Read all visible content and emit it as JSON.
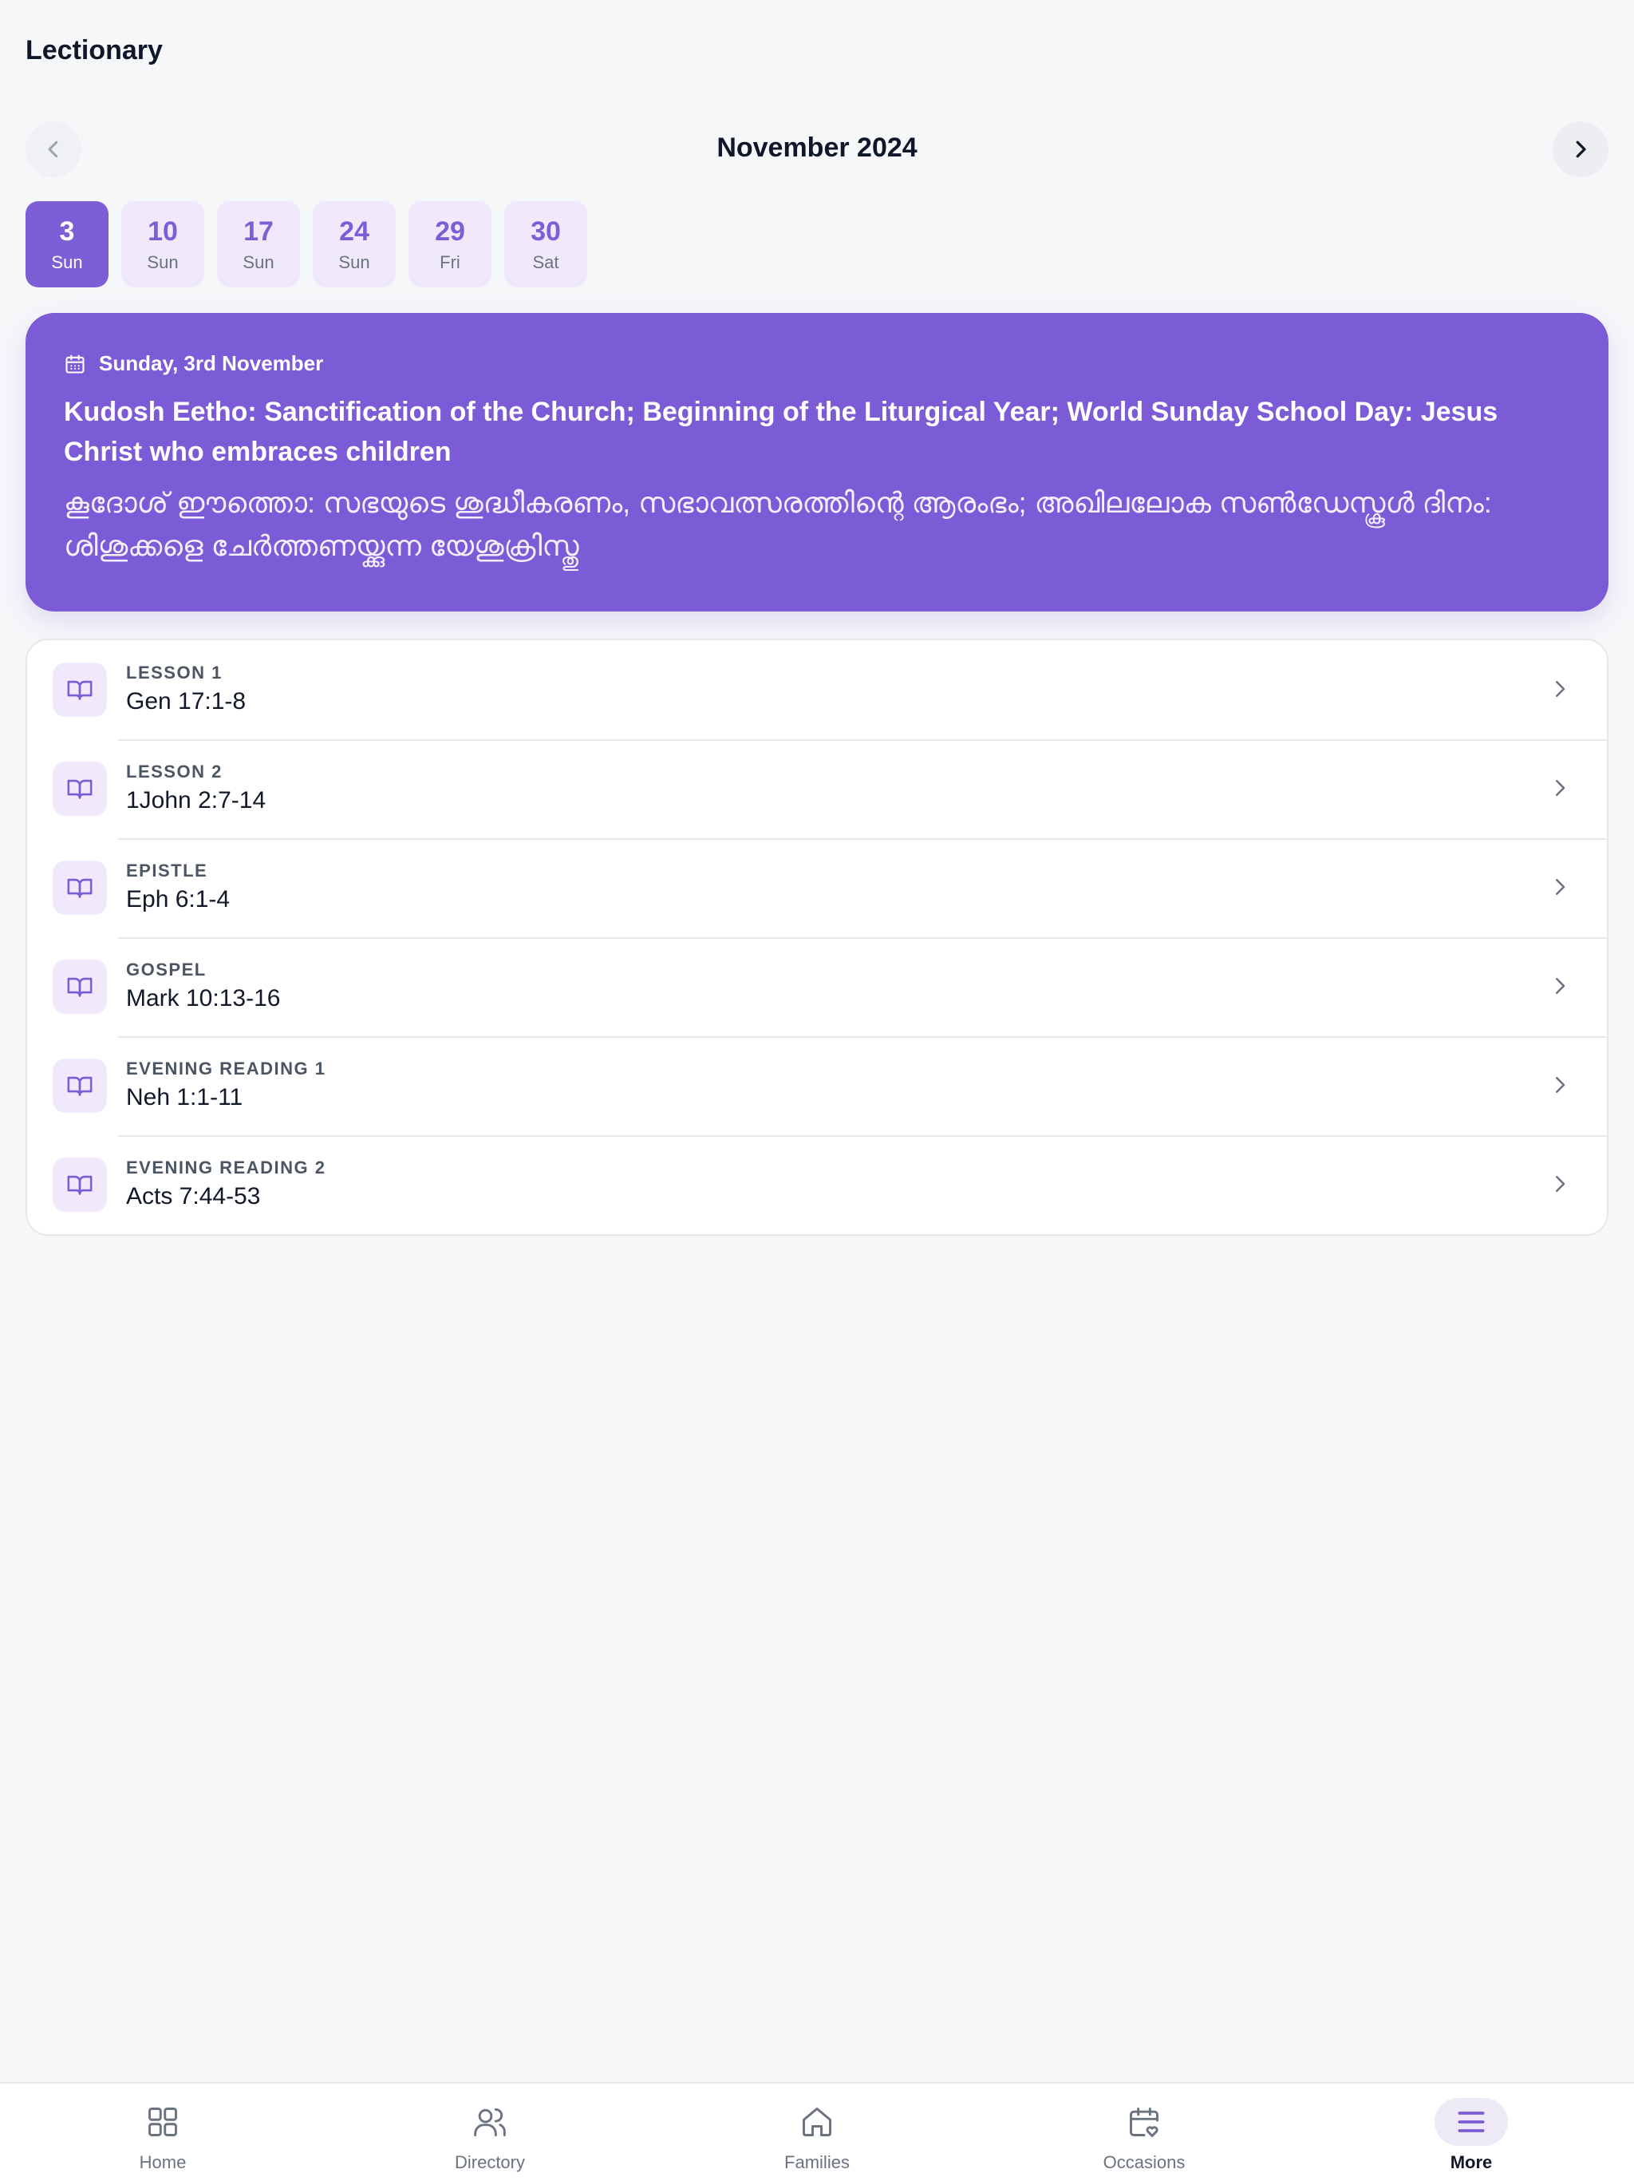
{
  "app": {
    "title": "Lectionary"
  },
  "month_nav": {
    "label": "November 2024"
  },
  "dates": [
    {
      "day": "3",
      "dow": "Sun",
      "selected": true
    },
    {
      "day": "10",
      "dow": "Sun",
      "selected": false
    },
    {
      "day": "17",
      "dow": "Sun",
      "selected": false
    },
    {
      "day": "24",
      "dow": "Sun",
      "selected": false
    },
    {
      "day": "29",
      "dow": "Fri",
      "selected": false
    },
    {
      "day": "30",
      "dow": "Sat",
      "selected": false
    }
  ],
  "day_card": {
    "date": "Sunday, 3rd November",
    "title": "Kudosh Eetho: Sanctification of the Church; Beginning of the Liturgical Year; World Sunday School Day: Jesus Christ who embraces children",
    "title_ml": "കൂദോശ് ഈത്തൊ: സഭയുടെ ശുദ്ധീകരണം, സഭാവത്സരത്തിന്റെ ആരംഭം; അഖിലലോക സൺഡേസ്കൂൾ ദിനം: ശിശുക്കളെ ചേർത്തണയ്ക്കുന്ന യേശുക്രിസ്തു"
  },
  "readings": [
    {
      "label": "LESSON 1",
      "ref": "Gen 17:1-8"
    },
    {
      "label": "LESSON 2",
      "ref": "1John 2:7-14"
    },
    {
      "label": "EPISTLE",
      "ref": "Eph 6:1-4"
    },
    {
      "label": "GOSPEL",
      "ref": "Mark 10:13-16"
    },
    {
      "label": "EVENING READING 1",
      "ref": "Neh 1:1-11"
    },
    {
      "label": "EVENING READING 2",
      "ref": "Acts 7:44-53"
    }
  ],
  "bottom_nav": [
    {
      "label": "Home",
      "icon": "grid-icon"
    },
    {
      "label": "Directory",
      "icon": "users-icon"
    },
    {
      "label": "Families",
      "icon": "home-icon"
    },
    {
      "label": "Occasions",
      "icon": "calendar-heart-icon"
    },
    {
      "label": "More",
      "icon": "menu-icon",
      "active": true
    }
  ],
  "colors": {
    "accent": "#7c5cd6",
    "accent_light": "#efe9fb",
    "background": "#f6f7f9",
    "text": "#0f172a"
  }
}
